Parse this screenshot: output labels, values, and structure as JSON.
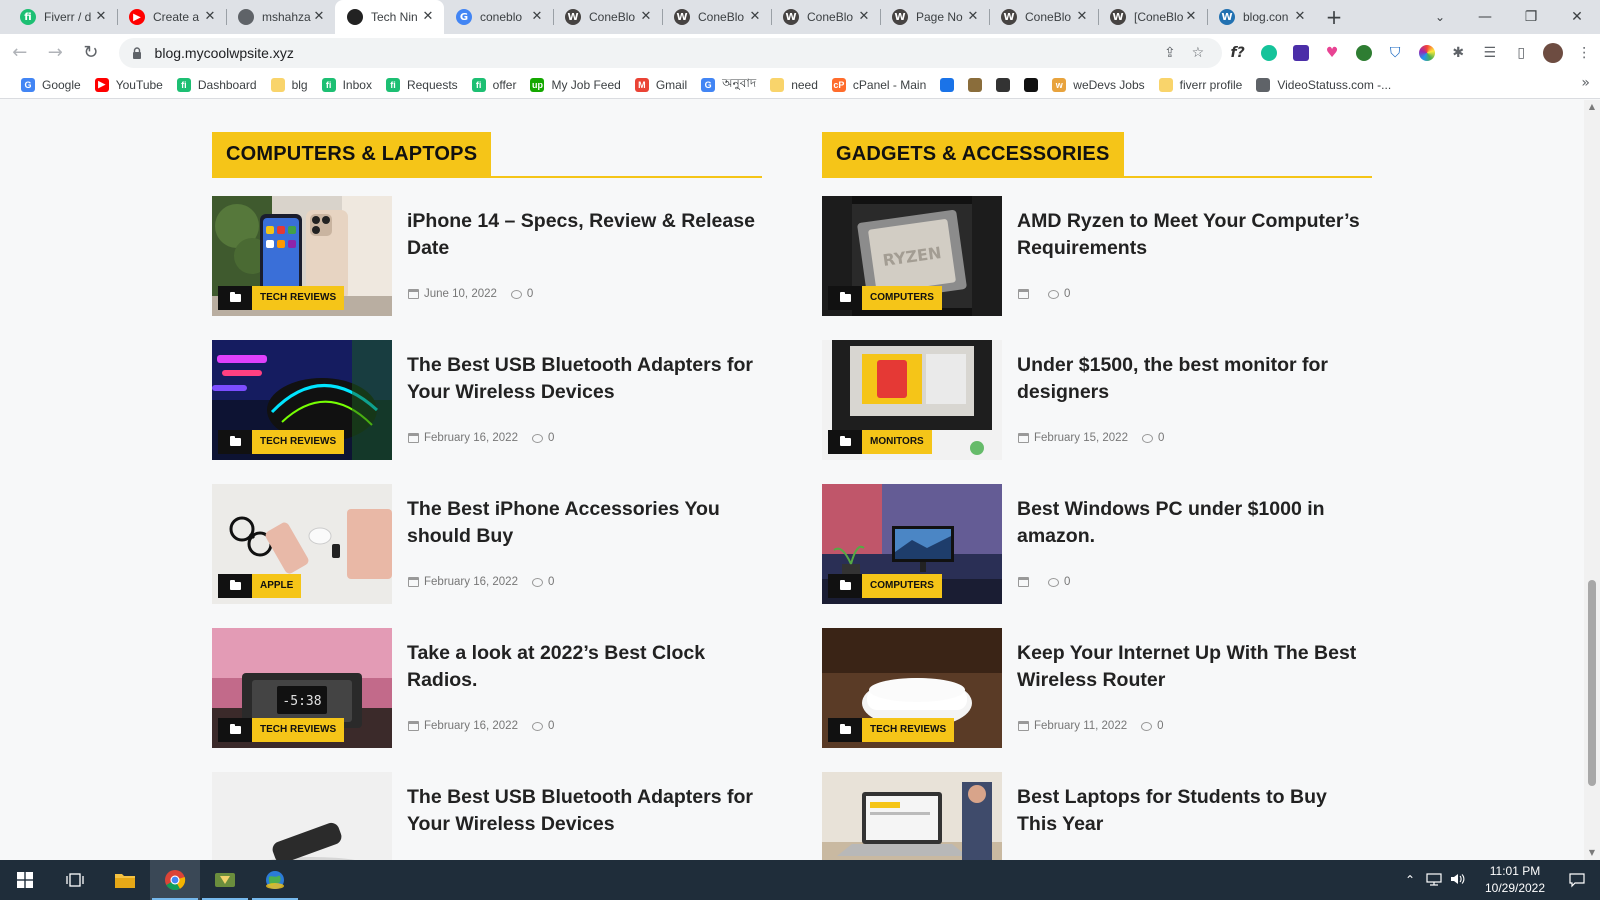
{
  "browser": {
    "tabs": [
      {
        "title": "Fiverr / d",
        "icon": "fiverr-icon",
        "color": "#1dbf73",
        "glyph": "fi"
      },
      {
        "title": "Create a",
        "icon": "youtube-icon",
        "color": "#ff0000",
        "glyph": "▶"
      },
      {
        "title": "mshahza",
        "icon": "globe-icon",
        "color": "#5f6368",
        "glyph": ""
      },
      {
        "title": "Tech Nin",
        "icon": "tech-ninja-icon",
        "color": "#222222",
        "glyph": "",
        "active": true
      },
      {
        "title": "coneblo",
        "icon": "google-icon",
        "color": "#4285f4",
        "glyph": "G"
      },
      {
        "title": "ConeBlo",
        "icon": "wordpress-icon",
        "color": "#464342",
        "glyph": "W"
      },
      {
        "title": "ConeBlo",
        "icon": "wordpress-icon",
        "color": "#464342",
        "glyph": "W"
      },
      {
        "title": "ConeBlo",
        "icon": "wordpress-icon",
        "color": "#464342",
        "glyph": "W"
      },
      {
        "title": "Page No",
        "icon": "wordpress-icon",
        "color": "#464342",
        "glyph": "W"
      },
      {
        "title": "ConeBlo",
        "icon": "wordpress-icon",
        "color": "#464342",
        "glyph": "W"
      },
      {
        "title": "[ConeBlo",
        "icon": "wordpress-icon",
        "color": "#464342",
        "glyph": "W"
      },
      {
        "title": "blog.con",
        "icon": "wordpress-icon",
        "color": "#2271b1",
        "glyph": "W"
      }
    ],
    "url": "blog.mycoolwpsite.xyz",
    "bookmarks": [
      {
        "label": "Google",
        "color": "#4285f4",
        "glyph": "G"
      },
      {
        "label": "YouTube",
        "color": "#ff0000",
        "glyph": "▶"
      },
      {
        "label": "Dashboard",
        "color": "#1dbf73",
        "glyph": "fi"
      },
      {
        "label": "blg",
        "color": "#f9d46b",
        "glyph": ""
      },
      {
        "label": "Inbox",
        "color": "#1dbf73",
        "glyph": "fi"
      },
      {
        "label": "Requests",
        "color": "#1dbf73",
        "glyph": "fi"
      },
      {
        "label": "offer",
        "color": "#1dbf73",
        "glyph": "fi"
      },
      {
        "label": "My Job Feed",
        "color": "#14a800",
        "glyph": "up"
      },
      {
        "label": "Gmail",
        "color": "#ea4335",
        "glyph": "M"
      },
      {
        "label": "অনুবাদ",
        "color": "#4285f4",
        "glyph": "G"
      },
      {
        "label": "need",
        "color": "#f9d46b",
        "glyph": ""
      },
      {
        "label": "cPanel - Main",
        "color": "#ff6c2c",
        "glyph": "cP"
      },
      {
        "label": "",
        "color": "#1a73e8",
        "glyph": ""
      },
      {
        "label": "",
        "color": "#8a6d3b",
        "glyph": ""
      },
      {
        "label": "",
        "color": "#333333",
        "glyph": ""
      },
      {
        "label": "",
        "color": "#111111",
        "glyph": ""
      },
      {
        "label": "weDevs Jobs",
        "color": "#e8a33d",
        "glyph": "w"
      },
      {
        "label": "fiverr profile",
        "color": "#f9d46b",
        "glyph": ""
      },
      {
        "label": "VideoStatuss.com -...",
        "color": "#5f6368",
        "glyph": ""
      }
    ]
  },
  "page": {
    "columns": [
      {
        "heading": "COMPUTERS & LAPTOPS",
        "posts": [
          {
            "title": "iPhone 14 – Specs, Review & Release Date",
            "category": "TECH REVIEWS",
            "date": "June 10, 2022",
            "comments": "0",
            "img": "iphone"
          },
          {
            "title": "The Best USB Bluetooth Adapters for Your Wireless Devices",
            "category": "TECH REVIEWS",
            "date": "February 16, 2022",
            "comments": "0",
            "img": "mouse"
          },
          {
            "title": "The Best iPhone Accessories You should Buy",
            "category": "APPLE",
            "date": "February 16, 2022",
            "comments": "0",
            "img": "accessories"
          },
          {
            "title": "Take a look at 2022’s Best Clock Radios.",
            "category": "TECH REVIEWS",
            "date": "February 16, 2022",
            "comments": "0",
            "img": "clock"
          },
          {
            "title": "The Best USB Bluetooth Adapters for Your Wireless Devices",
            "category": "",
            "date": "",
            "comments": "",
            "img": "usb"
          }
        ]
      },
      {
        "heading": "GADGETS & ACCESSORIES",
        "posts": [
          {
            "title": "AMD Ryzen to Meet Your Computer’s Requirements",
            "category": "COMPUTERS",
            "date": "",
            "comments": "0",
            "img": "ryzen"
          },
          {
            "title": "Under $1500, the best monitor for designers",
            "category": "MONITORS",
            "date": "February 15, 2022",
            "comments": "0",
            "img": "monitor"
          },
          {
            "title": "Best Windows PC under $1000 in amazon.",
            "category": "COMPUTERS",
            "date": "",
            "comments": "0",
            "img": "pc"
          },
          {
            "title": "Keep Your Internet Up With The Best Wireless Router",
            "category": "TECH REVIEWS",
            "date": "February 11, 2022",
            "comments": "0",
            "img": "router"
          },
          {
            "title": "Best Laptops for Students to Buy This Year",
            "category": "",
            "date": "",
            "comments": "",
            "img": "laptop"
          }
        ]
      }
    ]
  },
  "taskbar": {
    "time": "11:01 PM",
    "date": "10/29/2022"
  },
  "colors": {
    "accent": "#f5c518",
    "text": "#222222",
    "meta": "#777777"
  }
}
